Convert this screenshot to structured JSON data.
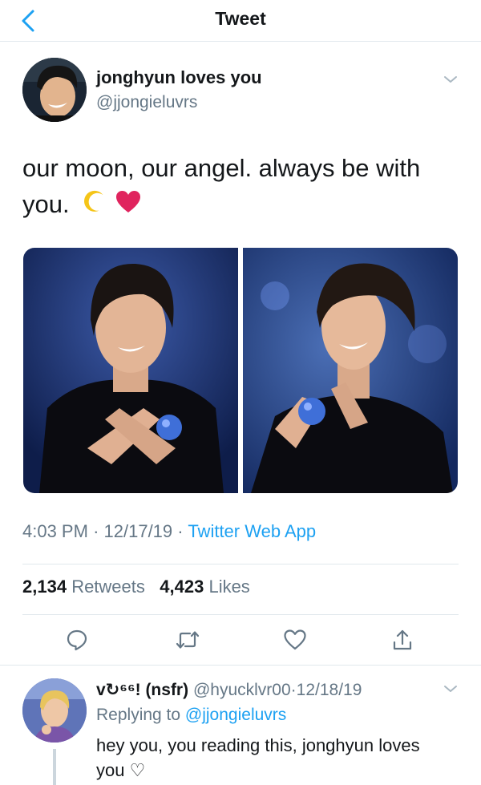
{
  "header": {
    "title": "Tweet",
    "back_icon": "chevron-left-icon"
  },
  "tweet": {
    "author_name": "jonghyun loves you",
    "author_handle": "@jjongieluvrs",
    "text": "our moon, our angel. always be with you.",
    "emojis": [
      "crescent-moon-emoji",
      "red-heart-emoji"
    ],
    "time": "4:03 PM",
    "date": "12/17/19",
    "separator": "·",
    "source": "Twitter Web App",
    "retweets_count": "2,134",
    "retweets_label": "Retweets",
    "likes_count": "4,423",
    "likes_label": "Likes"
  },
  "actions": [
    "reply-icon",
    "retweet-icon",
    "like-icon",
    "share-icon"
  ],
  "reply": {
    "name": "v↻⁶⁶! (nsfr)",
    "handle": "@hyucklvr00",
    "date": "12/18/19",
    "replying_label": "Replying to",
    "replying_to": "@jjongieluvrs",
    "text": "hey you, you reading this, jonghyun loves you ♡"
  },
  "colors": {
    "accent": "#1da1f2",
    "secondary_text": "#657786",
    "divider": "#e1e8ed",
    "heart": "#e0245e"
  }
}
